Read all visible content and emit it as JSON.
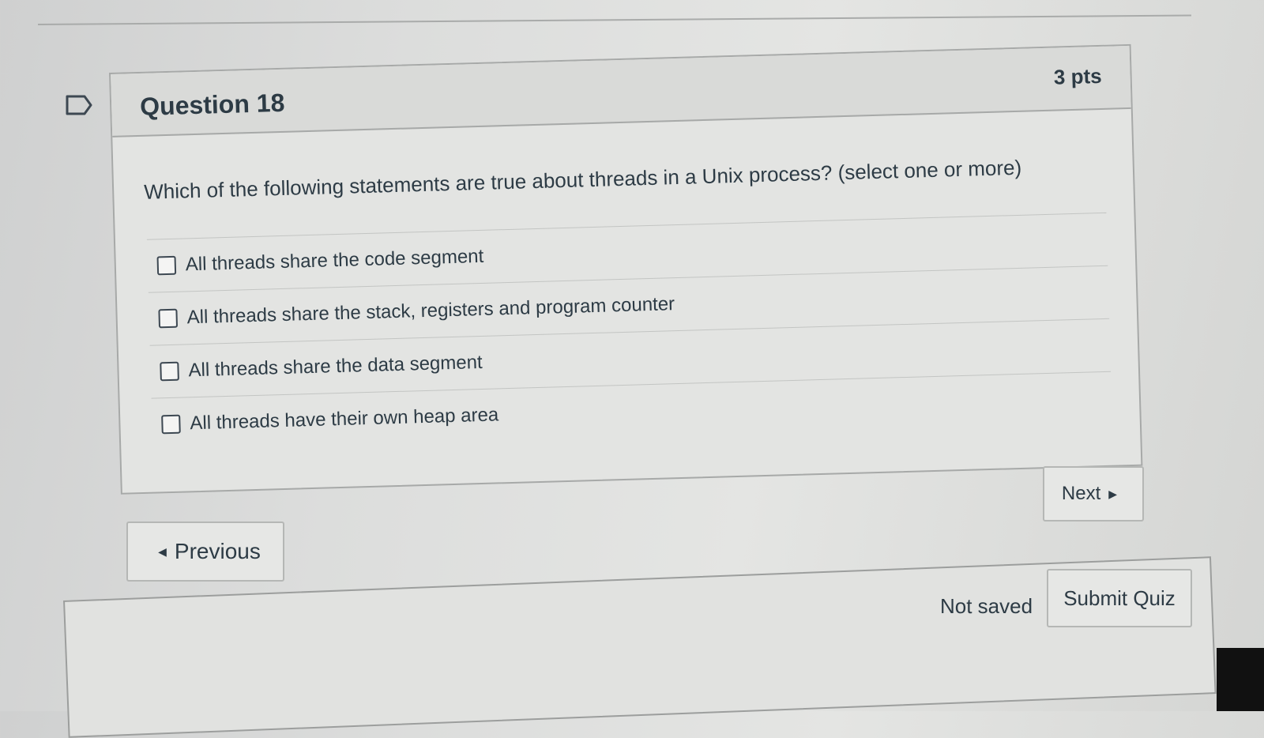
{
  "question": {
    "title": "Question 18",
    "points": "3 pts",
    "text": "Which of the following statements are true about threads in a Unix process? (select one or more)",
    "answers": [
      {
        "label": "All threads share the code segment",
        "checked": false
      },
      {
        "label": "All threads share the stack, registers and program counter",
        "checked": false
      },
      {
        "label": "All threads share the data segment",
        "checked": false
      },
      {
        "label": "All threads have their own heap area",
        "checked": false
      }
    ]
  },
  "nav": {
    "previous_label": "Previous",
    "next_label": "Next"
  },
  "footer": {
    "status": "Not saved",
    "submit_label": "Submit Quiz"
  }
}
